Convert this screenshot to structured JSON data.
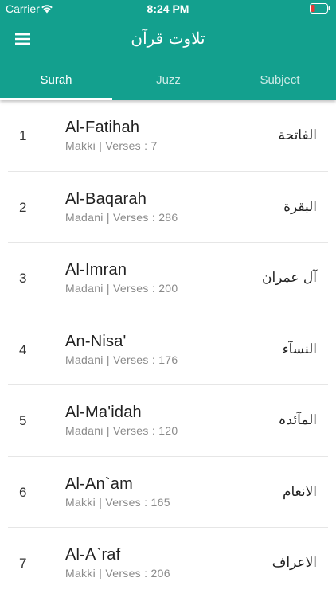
{
  "status_bar": {
    "carrier": "Carrier",
    "time": "8:24 PM",
    "wifi_icon": "wifi-icon",
    "battery_icon": "battery-low-icon",
    "battery_level_color": "#e53935"
  },
  "app_bar": {
    "title": "تلاوت قرآن",
    "menu_icon": "hamburger-menu-icon",
    "background_color": "#13a08e"
  },
  "tabs": [
    {
      "label": "Surah",
      "active": true
    },
    {
      "label": "Juzz",
      "active": false
    },
    {
      "label": "Subject",
      "active": false
    }
  ],
  "surahs": [
    {
      "number": "1",
      "name": "Al-Fatihah",
      "meta": "Makki | Verses : 7",
      "arabic": "الفاتحة"
    },
    {
      "number": "2",
      "name": "Al-Baqarah",
      "meta": "Madani | Verses : 286",
      "arabic": "البقرة"
    },
    {
      "number": "3",
      "name": "Al-Imran",
      "meta": "Madani | Verses : 200",
      "arabic": "آل عمران"
    },
    {
      "number": "4",
      "name": "An-Nisa'",
      "meta": "Madani | Verses : 176",
      "arabic": "النسآء"
    },
    {
      "number": "5",
      "name": "Al-Ma'idah",
      "meta": "Madani | Verses : 120",
      "arabic": "المآئدہ"
    },
    {
      "number": "6",
      "name": "Al-An`am",
      "meta": "Makki | Verses : 165",
      "arabic": "الانعام"
    },
    {
      "number": "7",
      "name": "Al-A`raf",
      "meta": "Makki | Verses : 206",
      "arabic": "الاعراف"
    }
  ]
}
